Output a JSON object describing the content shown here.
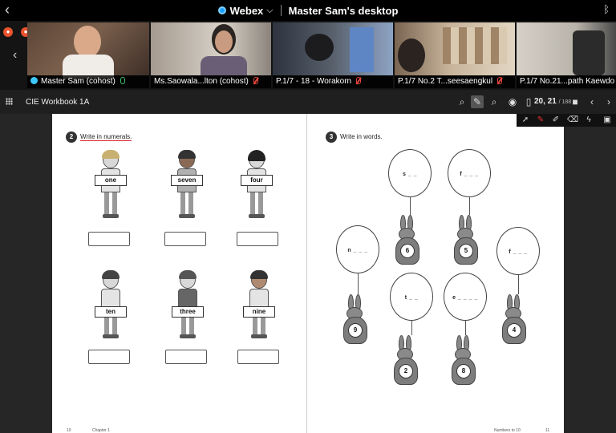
{
  "window": {
    "app_name": "Webex",
    "title": "Master Sam's desktop"
  },
  "participants": [
    {
      "name": "Master Sam (cohost)",
      "muted": false,
      "bg": "#6b5546"
    },
    {
      "name": "Ms.Saowala...lton (cohost)",
      "muted": true,
      "bg": "#8a7f78"
    },
    {
      "name": "P.1/7 - 18 - Worakorn",
      "muted": true,
      "bg": "#4a4f5a"
    },
    {
      "name": "P.1/7 No.2 T...seesaengkul",
      "muted": true,
      "bg": "#9b8a7a"
    },
    {
      "name": "P.1/7 No.21...path Kaewdo",
      "muted": true,
      "bg": "#c9c4bb"
    }
  ],
  "toolbar": {
    "doc_title": "CIE Workbook 1A",
    "page_current": "20, 21",
    "page_total": "/ 188"
  },
  "workbook": {
    "left": {
      "exercise_num": "2",
      "instruction": "Write in numerals.",
      "kids": [
        {
          "word": "one",
          "hair": "#c8b070"
        },
        {
          "word": "seven",
          "hair": "#333"
        },
        {
          "word": "four",
          "hair": "#222"
        },
        {
          "word": "ten",
          "hair": "#444"
        },
        {
          "word": "three",
          "hair": "#555"
        },
        {
          "word": "nine",
          "hair": "#333"
        }
      ],
      "footer_page": "10",
      "footer_chapter": "Chapter 1"
    },
    "right": {
      "exercise_num": "3",
      "instruction": "Write in words.",
      "balloons": [
        "s _ _",
        "f _ _ _",
        "n _ _ _",
        "f _ _ _",
        "t _ _",
        "e _ _ _ _"
      ],
      "rabbits": [
        "6",
        "5",
        "9",
        "4",
        "2",
        "8"
      ],
      "footer_title": "Numbers to 10",
      "footer_page": "11"
    }
  }
}
